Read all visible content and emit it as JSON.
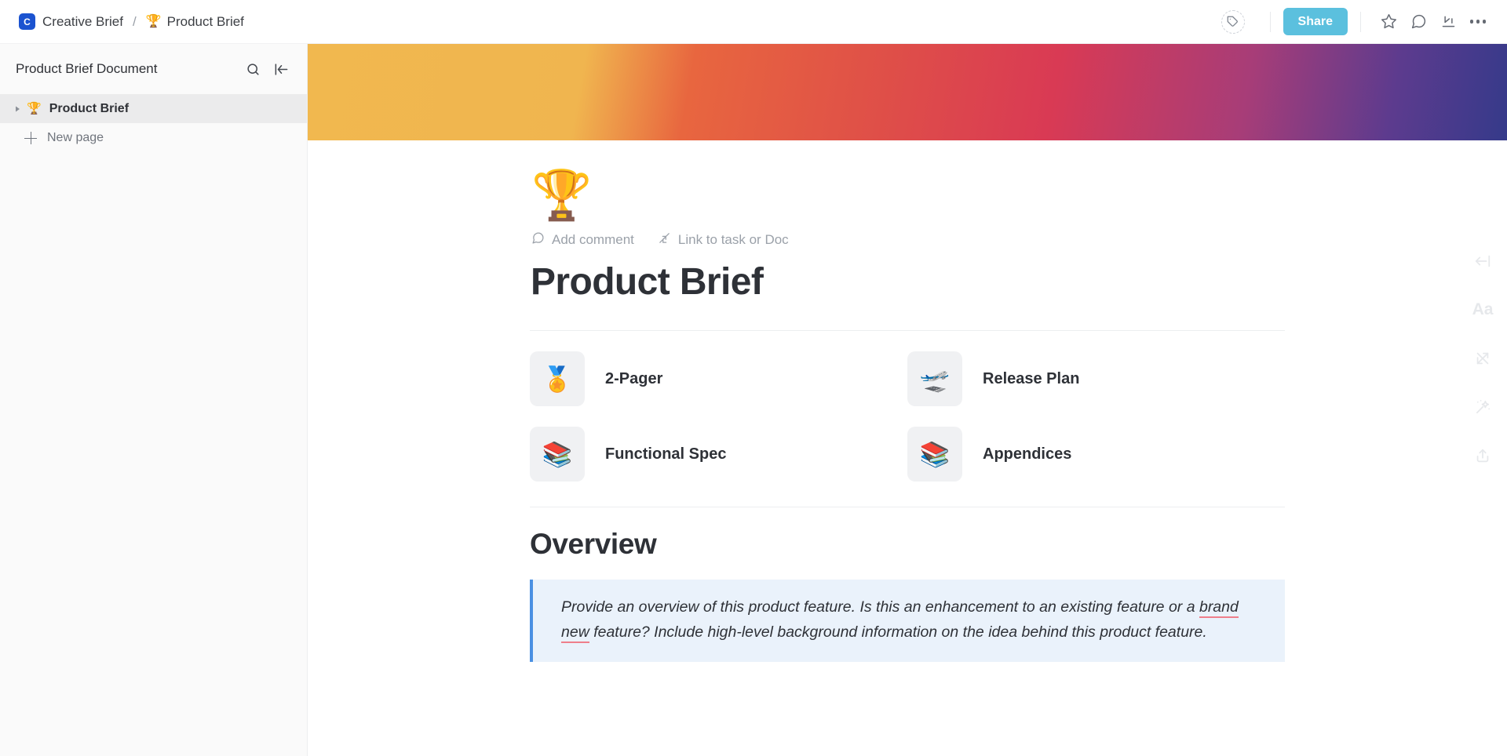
{
  "topbar": {
    "space_initial": "C",
    "space_name": "Creative Brief",
    "separator": "/",
    "page_emoji": "🏆",
    "page_name": "Product Brief",
    "tag_icon": "tag-icon",
    "share_label": "Share",
    "star_icon": "star-icon",
    "comment_icon": "comment-bubble-icon",
    "collapse_icon": "collapse-down-arrow-icon",
    "more_icon": "more-options-icon",
    "accent_share": "#5bc0de",
    "accent_space_chip": "#1b53d0"
  },
  "sidebar": {
    "title": "Product Brief Document",
    "search_icon": "search-icon",
    "collapse_icon": "collapse-sidebar-icon",
    "items": [
      {
        "emoji": "🏆",
        "label": "Product Brief",
        "active": true
      }
    ],
    "new_page_label": "New page"
  },
  "document": {
    "banner_colors": [
      "#f1b84f",
      "#e8663f",
      "#d93a54",
      "#a73d78",
      "#353a8a"
    ],
    "cover_emoji": "🏆",
    "actions": [
      {
        "icon": "comment-bubble-icon",
        "label": "Add comment"
      },
      {
        "icon": "link-task-icon",
        "label": "Link to task or Doc"
      }
    ],
    "title": "Product Brief",
    "cards": [
      {
        "emoji": "🏅",
        "label": "2-Pager"
      },
      {
        "emoji": "🛫",
        "label": "Release Plan"
      },
      {
        "emoji": "📚",
        "label": "Functional Spec"
      },
      {
        "emoji": "📚",
        "label": "Appendices"
      }
    ],
    "overview": {
      "heading": "Overview",
      "callout_part1": "Provide an overview of this product feature. Is this an enhancement to an existing feature or a ",
      "callout_spellcheck": "brand new",
      "callout_part2": " feature? Include high-level background information on the idea behind this product feature.",
      "callout_border_color": "#4a90e2",
      "callout_background": "#eaf2fb",
      "spellcheck_underline_color": "#ef7f8b"
    }
  },
  "right_rail": {
    "items": [
      {
        "icon": "expand-width-icon",
        "glyph": "arrow"
      },
      {
        "icon": "typography-icon",
        "glyph": "Aa"
      },
      {
        "icon": "relationships-icon",
        "glyph": "arrows"
      },
      {
        "icon": "ai-magic-wand-icon",
        "glyph": "wand"
      },
      {
        "icon": "share-export-icon",
        "glyph": "upload"
      }
    ]
  }
}
